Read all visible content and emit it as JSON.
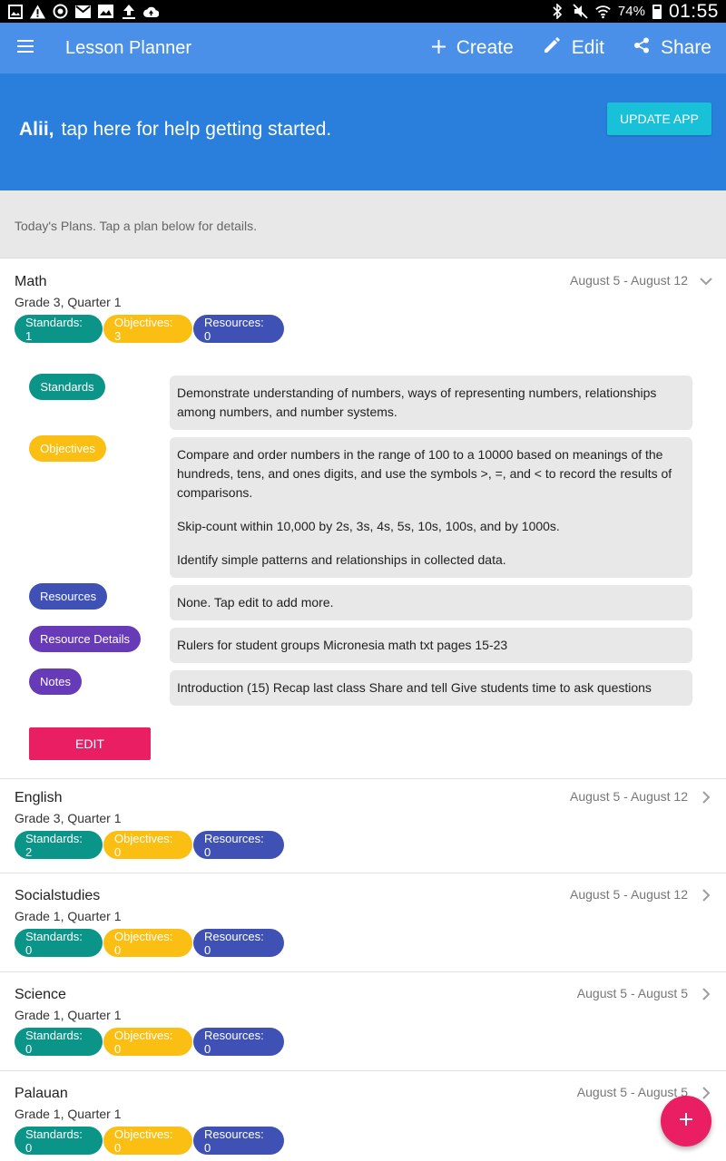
{
  "status_bar": {
    "battery": "74%",
    "time": "01:55"
  },
  "app_bar": {
    "title": "Lesson Planner",
    "actions": {
      "create": "Create",
      "edit": "Edit",
      "share": "Share"
    }
  },
  "banner": {
    "name": "Alii,",
    "message": "tap here for help getting started.",
    "update_button": "UPDATE APP"
  },
  "today_header": "Today's Plans. Tap a plan below for details.",
  "plans": [
    {
      "subject": "Math",
      "grade": "Grade 3, Quarter 1",
      "dates": "August 5 - August 12",
      "expanded": true,
      "chips": {
        "standards": "Standards: 1",
        "objectives": "Objectives: 3",
        "resources": "Resources: 0"
      },
      "details": {
        "standards_label": "Standards",
        "standards_text": "Demonstrate understanding of numbers, ways of representing numbers, relationships among numbers, and number systems.",
        "objectives_label": "Objectives",
        "objectives": [
          "Compare and order numbers in the range of 100 to a 10000 based on meanings of the hundreds, tens, and ones digits, and use the symbols >, =, and < to record the results of comparisons.",
          "Skip-count within 10,000 by 2s, 3s, 4s, 5s, 10s, 100s, and by 1000s.",
          "Identify simple patterns and relationships in collected data."
        ],
        "resources_label": "Resources",
        "resources_text": "None. Tap edit to add more.",
        "resource_details_label": "Resource Details",
        "resource_details_text": "Rulers for student groups Micronesia math txt pages 15-23",
        "notes_label": "Notes",
        "notes_text": "Introduction (15) Recap last class Share and tell Give students time to ask questions",
        "edit_button": "EDIT"
      }
    },
    {
      "subject": "English",
      "grade": "Grade 3, Quarter 1",
      "dates": "August 5 - August 12",
      "expanded": false,
      "chips": {
        "standards": "Standards: 2",
        "objectives": "Objectives: 0",
        "resources": "Resources: 0"
      }
    },
    {
      "subject": "Socialstudies",
      "grade": "Grade 1, Quarter 1",
      "dates": "August 5 - August 12",
      "expanded": false,
      "chips": {
        "standards": "Standards: 0",
        "objectives": "Objectives: 0",
        "resources": "Resources: 0"
      }
    },
    {
      "subject": "Science",
      "grade": "Grade 1, Quarter 1",
      "dates": "August 5 - August 5",
      "expanded": false,
      "chips": {
        "standards": "Standards: 0",
        "objectives": "Objectives: 0",
        "resources": "Resources: 0"
      }
    },
    {
      "subject": "Palauan",
      "grade": "Grade 1, Quarter 1",
      "dates": "August 5 - August 5",
      "expanded": false,
      "chips": {
        "standards": "Standards: 0",
        "objectives": "Objectives: 0",
        "resources": "Resources: 0"
      }
    }
  ],
  "colors": {
    "app_bar": "#4a90e8",
    "banner": "#2a7fdc",
    "update_button": "#18c0d8",
    "standards": "#0b9488",
    "objectives": "#fbbf13",
    "resources": "#3f51b5",
    "resource_details": "#673ab7",
    "notes": "#673ab7",
    "accent": "#e91e63"
  },
  "icons": {
    "status_left": [
      "image-icon",
      "warning-icon",
      "sync-icon",
      "mail-icon",
      "gallery-icon",
      "upload-icon",
      "cloud-upload-icon"
    ],
    "status_right": [
      "bluetooth-icon",
      "mute-icon",
      "wifi-icon",
      "battery-icon"
    ],
    "menu": "menu-icon",
    "create": "plus-icon",
    "edit": "pencil-icon",
    "share": "share-icon",
    "expanded": "chevron-down-icon",
    "collapsed": "chevron-right-icon",
    "fab": "plus-icon"
  }
}
